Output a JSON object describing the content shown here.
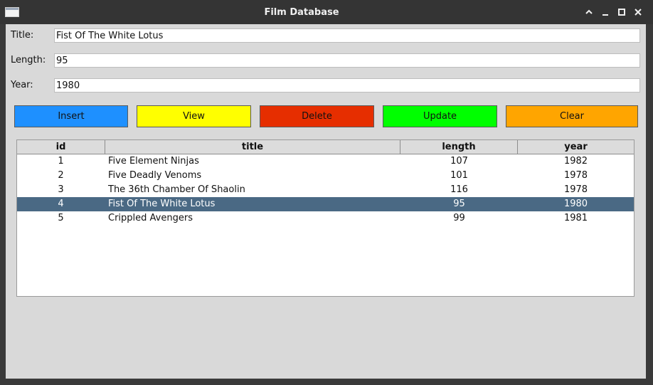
{
  "window": {
    "title": "Film Database",
    "icon": "app-window-icon",
    "controls": [
      "chevron-up-icon",
      "minimize-icon",
      "maximize-icon",
      "close-icon"
    ]
  },
  "form": {
    "title_label": "Title:",
    "title_value": "Fist Of The White Lotus",
    "length_label": "Length:",
    "length_value": "95",
    "year_label": "Year:",
    "year_value": "1980"
  },
  "buttons": {
    "insert": {
      "label": "Insert",
      "color": "#1e90ff"
    },
    "view": {
      "label": "View",
      "color": "#ffff00"
    },
    "delete": {
      "label": "Delete",
      "color": "#e62e00"
    },
    "update": {
      "label": "Update",
      "color": "#00ff00"
    },
    "clear": {
      "label": "Clear",
      "color": "#ffa500"
    }
  },
  "table": {
    "columns": [
      "id",
      "title",
      "length",
      "year"
    ],
    "rows": [
      {
        "id": "1",
        "title": "Five Element Ninjas",
        "length": "107",
        "year": "1982"
      },
      {
        "id": "2",
        "title": "Five Deadly Venoms",
        "length": "101",
        "year": "1978"
      },
      {
        "id": "3",
        "title": "The 36th Chamber Of Shaolin",
        "length": "116",
        "year": "1978"
      },
      {
        "id": "4",
        "title": "Fist Of The White Lotus",
        "length": "95",
        "year": "1980"
      },
      {
        "id": "5",
        "title": "Crippled Avengers",
        "length": "99",
        "year": "1981"
      }
    ],
    "selected_row_index": 3,
    "selection_color": "#4a6984"
  }
}
